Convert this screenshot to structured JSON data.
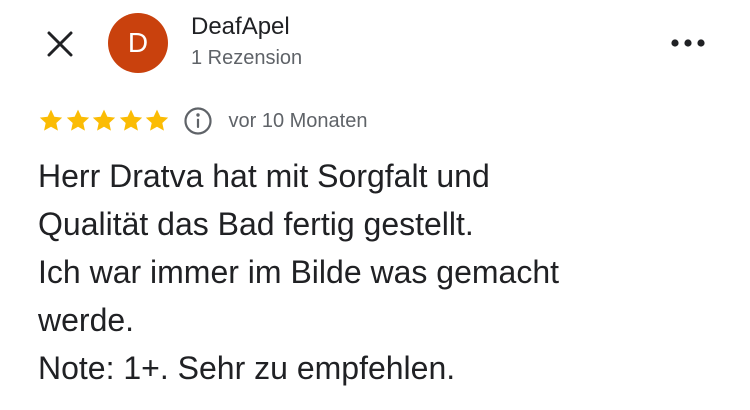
{
  "header": {
    "avatar_initial": "D",
    "avatar_color": "#c9410d",
    "user_name": "DeafApel",
    "review_count": "1 Rezension",
    "close_icon": "close-icon",
    "more_icon": "more-horizontal-icon"
  },
  "review": {
    "rating": 5,
    "rating_max": 5,
    "star_color": "#fbbc04",
    "date": "vor 10 Monaten",
    "lines": [
      "Herr Dratva hat mit Sorgfalt und",
      "Qualität das Bad fertig gestellt.",
      "Ich war immer im Bilde was gemacht",
      "werde.",
      "Note: 1+. Sehr zu empfehlen."
    ]
  }
}
